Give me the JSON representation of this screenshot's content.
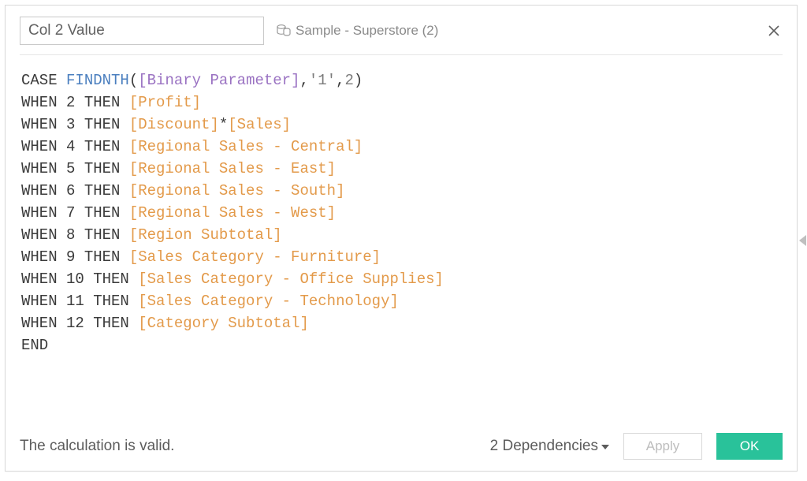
{
  "header": {
    "calc_name": "Col 2 Value",
    "datasource_label": "Sample - Superstore (2)"
  },
  "formula": {
    "lines": [
      [
        {
          "t": "kw",
          "v": "CASE "
        },
        {
          "t": "fn",
          "v": "FINDNTH"
        },
        {
          "t": "op",
          "v": "("
        },
        {
          "t": "param",
          "v": "[Binary Parameter]"
        },
        {
          "t": "op",
          "v": ","
        },
        {
          "t": "lit",
          "v": "'1'"
        },
        {
          "t": "op",
          "v": ","
        },
        {
          "t": "lit",
          "v": "2"
        },
        {
          "t": "op",
          "v": ")"
        }
      ],
      [
        {
          "t": "kw",
          "v": "WHEN 2 THEN "
        },
        {
          "t": "field",
          "v": "[Profit]"
        }
      ],
      [
        {
          "t": "kw",
          "v": "WHEN 3 THEN "
        },
        {
          "t": "field",
          "v": "[Discount]"
        },
        {
          "t": "op",
          "v": "*"
        },
        {
          "t": "field",
          "v": "[Sales]"
        }
      ],
      [
        {
          "t": "kw",
          "v": "WHEN 4 THEN "
        },
        {
          "t": "field",
          "v": "[Regional Sales - Central]"
        }
      ],
      [
        {
          "t": "kw",
          "v": "WHEN 5 THEN "
        },
        {
          "t": "field",
          "v": "[Regional Sales - East]"
        }
      ],
      [
        {
          "t": "kw",
          "v": "WHEN 6 THEN "
        },
        {
          "t": "field",
          "v": "[Regional Sales - South]"
        }
      ],
      [
        {
          "t": "kw",
          "v": "WHEN 7 THEN "
        },
        {
          "t": "field",
          "v": "[Regional Sales - West]"
        }
      ],
      [
        {
          "t": "kw",
          "v": "WHEN 8 THEN "
        },
        {
          "t": "field",
          "v": "[Region Subtotal]"
        }
      ],
      [
        {
          "t": "kw",
          "v": "WHEN 9 THEN "
        },
        {
          "t": "field",
          "v": "[Sales Category - Furniture]"
        }
      ],
      [
        {
          "t": "kw",
          "v": "WHEN 10 THEN "
        },
        {
          "t": "field",
          "v": "[Sales Category - Office Supplies]"
        }
      ],
      [
        {
          "t": "kw",
          "v": "WHEN 11 THEN "
        },
        {
          "t": "field",
          "v": "[Sales Category - Technology]"
        }
      ],
      [
        {
          "t": "kw",
          "v": "WHEN 12 THEN "
        },
        {
          "t": "field",
          "v": "[Category Subtotal]"
        }
      ],
      [
        {
          "t": "kw",
          "v": "END"
        }
      ]
    ]
  },
  "footer": {
    "status": "The calculation is valid.",
    "dependencies_label": "2 Dependencies",
    "apply_label": "Apply",
    "ok_label": "OK"
  }
}
